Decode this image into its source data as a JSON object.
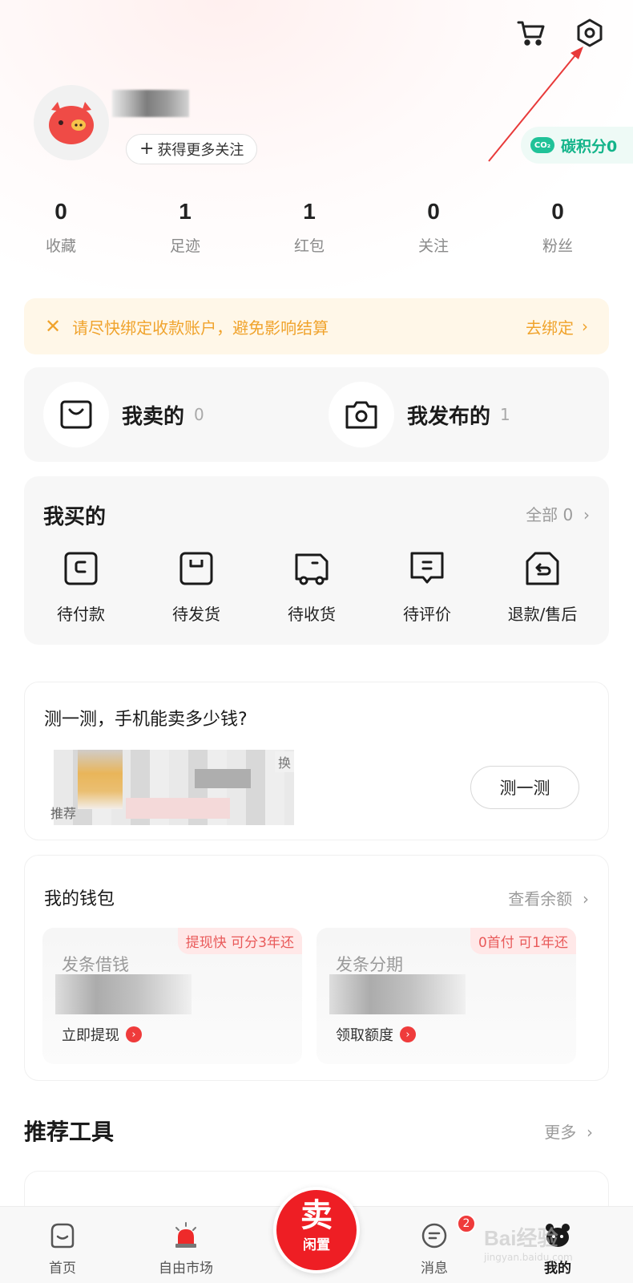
{
  "header": {
    "follow_button": "获得更多关注",
    "carbon_points": "碳积分0",
    "co2_label": "CO₂"
  },
  "stats": [
    {
      "value": "0",
      "label": "收藏"
    },
    {
      "value": "1",
      "label": "足迹"
    },
    {
      "value": "1",
      "label": "红包"
    },
    {
      "value": "0",
      "label": "关注"
    },
    {
      "value": "0",
      "label": "粉丝"
    }
  ],
  "banner": {
    "message": "请尽快绑定收款账户，避免影响结算",
    "action": "去绑定"
  },
  "sell_section": {
    "sold": {
      "label": "我卖的",
      "count": "0"
    },
    "published": {
      "label": "我发布的",
      "count": "1"
    }
  },
  "buy_section": {
    "title": "我买的",
    "all_label": "全部 0",
    "items": [
      {
        "label": "待付款"
      },
      {
        "label": "待发货"
      },
      {
        "label": "待收货"
      },
      {
        "label": "待评价"
      },
      {
        "label": "退款/售后"
      }
    ]
  },
  "test_section": {
    "title": "测一测，手机能卖多少钱?",
    "recommend_label": "推荐",
    "swap_label": "换",
    "button": "测一测"
  },
  "wallet": {
    "title": "我的钱包",
    "more": "查看余额",
    "borrow": {
      "name": "发条借钱",
      "tag": "提现快 可分3年还",
      "action": "立即提现"
    },
    "installment": {
      "name": "发条分期",
      "tag": "0首付 可1年还",
      "action": "领取额度"
    }
  },
  "tools": {
    "title": "推荐工具",
    "more": "更多"
  },
  "nav": {
    "home": "首页",
    "market": "自由市场",
    "sell_big": "卖",
    "sell_small": "闲置",
    "messages": "消息",
    "messages_badge": "2",
    "mine": "我的"
  },
  "watermark": {
    "text": "Bai经验",
    "sub": "jingyan.baidu.com"
  },
  "colors": {
    "accent_red": "#ee1e24",
    "banner_orange": "#f0a32c",
    "carbon_green": "#13b48a"
  }
}
